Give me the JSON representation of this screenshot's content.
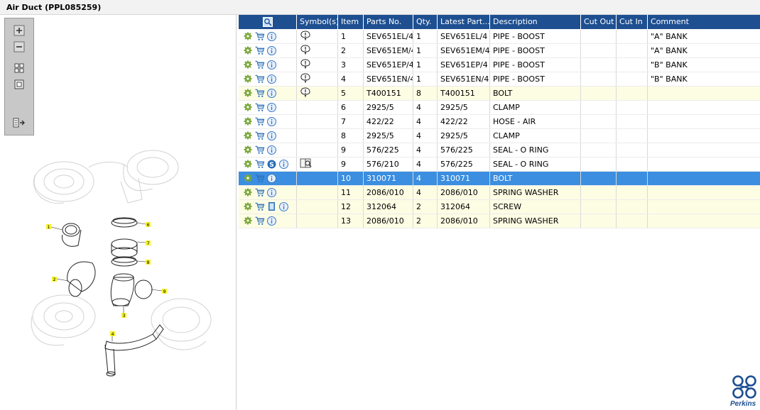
{
  "window": {
    "title": "Air Duct (PPL085259)"
  },
  "toolbar": {
    "buttons": [
      {
        "name": "zoom-in-button",
        "icon": "plus-icon"
      },
      {
        "name": "zoom-out-button",
        "icon": "minus-icon"
      },
      {
        "name": "fit-page-button",
        "icon": "grid-icon"
      },
      {
        "name": "actual-size-button",
        "icon": "square-icon"
      },
      {
        "name": "toggle-list-button",
        "icon": "list-arrow-icon"
      }
    ]
  },
  "diagram": {
    "callouts": [
      "1",
      "2",
      "3",
      "4",
      "6",
      "7",
      "8",
      "9"
    ]
  },
  "table": {
    "headers": [
      "",
      "Symbol(s)",
      "Item",
      "Parts No.",
      "Qty.",
      "Latest Part...",
      "Description",
      "Cut Out",
      "Cut In",
      "Comment"
    ],
    "rows": [
      {
        "item": "1",
        "parts_no": "SEV651EL/4",
        "qty": "1",
        "latest": "SEV651EL/4",
        "description": "PIPE - BOOST",
        "cut_out": "",
        "cut_in": "",
        "comment": "\"A\" BANK",
        "symbol": "note",
        "style": "plain",
        "extra_icon": ""
      },
      {
        "item": "2",
        "parts_no": "SEV651EM/4",
        "qty": "1",
        "latest": "SEV651EM/4",
        "description": "PIPE - BOOST",
        "cut_out": "",
        "cut_in": "",
        "comment": "\"A\" BANK",
        "symbol": "note",
        "style": "plain",
        "extra_icon": ""
      },
      {
        "item": "3",
        "parts_no": "SEV651EP/4",
        "qty": "1",
        "latest": "SEV651EP/4",
        "description": "PIPE - BOOST",
        "cut_out": "",
        "cut_in": "",
        "comment": "\"B\" BANK",
        "symbol": "note",
        "style": "plain",
        "extra_icon": ""
      },
      {
        "item": "4",
        "parts_no": "SEV651EN/4",
        "qty": "1",
        "latest": "SEV651EN/4",
        "description": "PIPE - BOOST",
        "cut_out": "",
        "cut_in": "",
        "comment": "\"B\" BANK",
        "symbol": "note",
        "style": "plain",
        "extra_icon": ""
      },
      {
        "item": "5",
        "parts_no": "T400151",
        "qty": "8",
        "latest": "T400151",
        "description": "BOLT",
        "cut_out": "",
        "cut_in": "",
        "comment": "",
        "symbol": "note",
        "style": "hl",
        "extra_icon": ""
      },
      {
        "item": "6",
        "parts_no": "2925/5",
        "qty": "4",
        "latest": "2925/5",
        "description": "CLAMP",
        "cut_out": "",
        "cut_in": "",
        "comment": "",
        "symbol": "",
        "style": "plain",
        "extra_icon": ""
      },
      {
        "item": "7",
        "parts_no": "422/22",
        "qty": "4",
        "latest": "422/22",
        "description": "HOSE - AIR",
        "cut_out": "",
        "cut_in": "",
        "comment": "",
        "symbol": "",
        "style": "plain",
        "extra_icon": ""
      },
      {
        "item": "8",
        "parts_no": "2925/5",
        "qty": "4",
        "latest": "2925/5",
        "description": "CLAMP",
        "cut_out": "",
        "cut_in": "",
        "comment": "",
        "symbol": "",
        "style": "plain",
        "extra_icon": ""
      },
      {
        "item": "9",
        "parts_no": "576/225",
        "qty": "4",
        "latest": "576/225",
        "description": "SEAL - O RING",
        "cut_out": "",
        "cut_in": "",
        "comment": "",
        "symbol": "",
        "style": "plain",
        "extra_icon": ""
      },
      {
        "item": "9",
        "parts_no": "576/210",
        "qty": "4",
        "latest": "576/225",
        "description": "SEAL - O RING",
        "cut_out": "",
        "cut_in": "",
        "comment": "",
        "symbol": "book",
        "style": "plain",
        "extra_icon": "s"
      },
      {
        "item": "10",
        "parts_no": "310071",
        "qty": "4",
        "latest": "310071",
        "description": "BOLT",
        "cut_out": "",
        "cut_in": "",
        "comment": "",
        "symbol": "",
        "style": "sel",
        "extra_icon": ""
      },
      {
        "item": "11",
        "parts_no": "2086/010",
        "qty": "4",
        "latest": "2086/010",
        "description": "SPRING WASHER",
        "cut_out": "",
        "cut_in": "",
        "comment": "",
        "symbol": "",
        "style": "hl",
        "extra_icon": ""
      },
      {
        "item": "12",
        "parts_no": "312064",
        "qty": "2",
        "latest": "312064",
        "description": "SCREW",
        "cut_out": "",
        "cut_in": "",
        "comment": "",
        "symbol": "",
        "style": "hl",
        "extra_icon": "doc"
      },
      {
        "item": "13",
        "parts_no": "2086/010",
        "qty": "2",
        "latest": "2086/010",
        "description": "SPRING WASHER",
        "cut_out": "",
        "cut_in": "",
        "comment": "",
        "symbol": "",
        "style": "hl",
        "extra_icon": ""
      }
    ]
  },
  "colors": {
    "header_bg": "#1d4f91",
    "selected_row": "#3b8ee0",
    "highlight_row": "#fdfde4",
    "gear": "#7aa83a",
    "info": "#3a78c8"
  },
  "logo": {
    "text": "Perkins"
  }
}
